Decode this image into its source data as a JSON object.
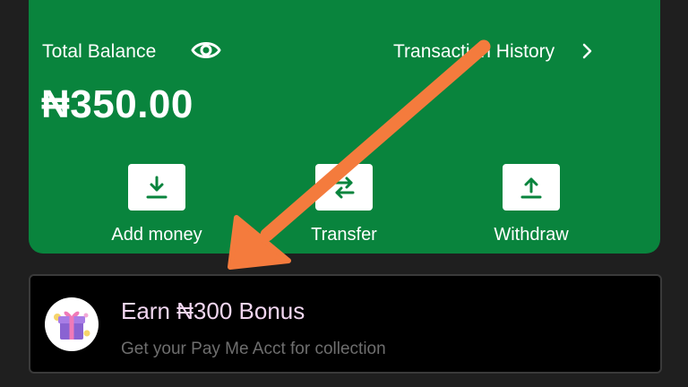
{
  "wallet": {
    "total_label": "Total Balance",
    "history_label": "Transaction History",
    "balance": "₦350.00"
  },
  "actions": [
    {
      "label": "Add money",
      "icon": "download-icon"
    },
    {
      "label": "Transfer",
      "icon": "transfer-icon"
    },
    {
      "label": "Withdraw",
      "icon": "upload-icon"
    }
  ],
  "bonus": {
    "title": "Earn ₦300 Bonus",
    "subtitle": "Get your Pay Me Acct for collection",
    "icon": "gift-icon"
  },
  "colors": {
    "card_green": "#09843d",
    "background": "#1f1f1f",
    "annotation_arrow": "#f47b3d",
    "bonus_title": "#f1d6f0"
  }
}
